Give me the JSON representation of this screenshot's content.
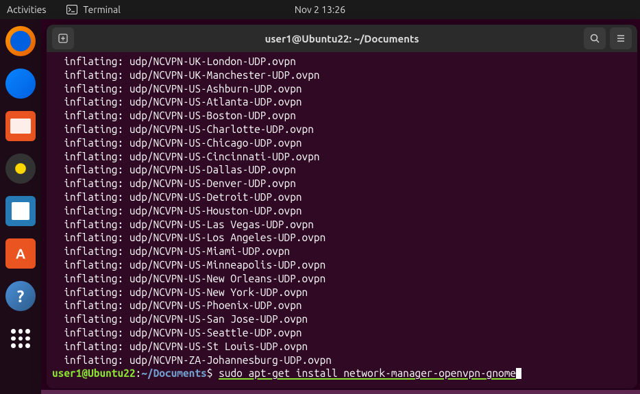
{
  "topbar": {
    "activities": "Activities",
    "app_name": "Terminal",
    "datetime": "Nov 2  13:26"
  },
  "window": {
    "title": "user1@Ubuntu22: ~/Documents"
  },
  "terminal": {
    "lines": [
      "  inflating: udp/NCVPN-UK-London-UDP.ovpn",
      "  inflating: udp/NCVPN-UK-Manchester-UDP.ovpn",
      "  inflating: udp/NCVPN-US-Ashburn-UDP.ovpn",
      "  inflating: udp/NCVPN-US-Atlanta-UDP.ovpn",
      "  inflating: udp/NCVPN-US-Boston-UDP.ovpn",
      "  inflating: udp/NCVPN-US-Charlotte-UDP.ovpn",
      "  inflating: udp/NCVPN-US-Chicago-UDP.ovpn",
      "  inflating: udp/NCVPN-US-Cincinnati-UDP.ovpn",
      "  inflating: udp/NCVPN-US-Dallas-UDP.ovpn",
      "  inflating: udp/NCVPN-US-Denver-UDP.ovpn",
      "  inflating: udp/NCVPN-US-Detroit-UDP.ovpn",
      "  inflating: udp/NCVPN-US-Houston-UDP.ovpn",
      "  inflating: udp/NCVPN-US-Las Vegas-UDP.ovpn",
      "  inflating: udp/NCVPN-US-Los Angeles-UDP.ovpn",
      "  inflating: udp/NCVPN-US-Miami-UDP.ovpn",
      "  inflating: udp/NCVPN-US-Minneapolis-UDP.ovpn",
      "  inflating: udp/NCVPN-US-New Orleans-UDP.ovpn",
      "  inflating: udp/NCVPN-US-New York-UDP.ovpn",
      "  inflating: udp/NCVPN-US-Phoenix-UDP.ovpn",
      "  inflating: udp/NCVPN-US-San Jose-UDP.ovpn",
      "  inflating: udp/NCVPN-US-Seattle-UDP.ovpn",
      "  inflating: udp/NCVPN-US-St Louis-UDP.ovpn",
      "  inflating: udp/NCVPN-ZA-Johannesburg-UDP.ovpn"
    ],
    "prompt": {
      "userhost": "user1@Ubuntu22",
      "colon": ":",
      "path": "~/Documents",
      "dollar": "$ ",
      "command": "sudo apt-get install network-manager-openvpn-gnome"
    }
  }
}
